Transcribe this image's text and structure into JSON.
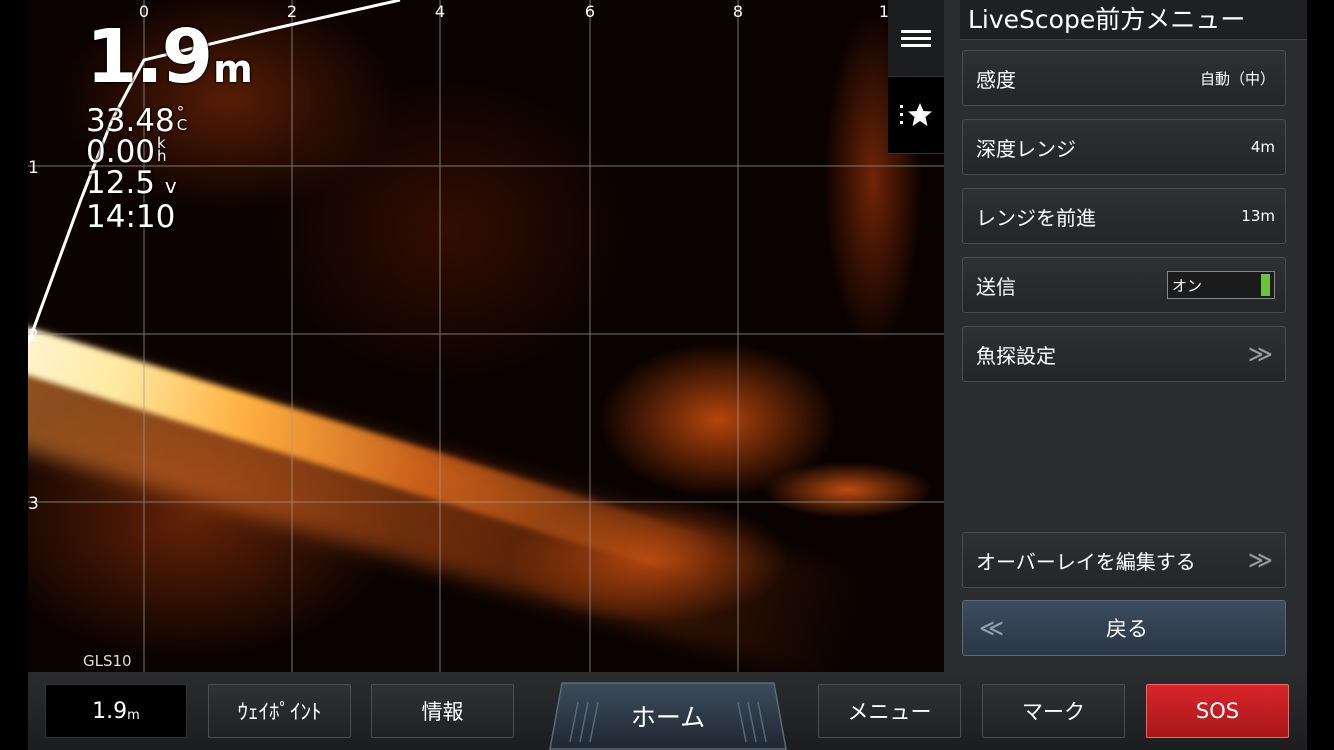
{
  "sonar": {
    "x_ticks": [
      "0",
      "2",
      "4",
      "6",
      "8",
      "1"
    ],
    "y_ticks": [
      "1",
      "2",
      "3"
    ],
    "depth": "1.9",
    "depth_unit": "m",
    "water_temp": "33.48",
    "temp_unit_top": "°",
    "temp_unit_bottom": "C",
    "speed": "0.00",
    "speed_unit_top": "k",
    "speed_unit_bottom": "h",
    "voltage": "12.5",
    "voltage_unit": "v",
    "time": "14:10",
    "transducer": "GLS10",
    "colors": {
      "echo": "#e06a1c",
      "bottom": "#ffe9a0",
      "grid": "#8a8a8a"
    }
  },
  "tool_strip": {
    "menu_icon": "hamburger-icon",
    "favorites_icon": "favorites-star-icon"
  },
  "menu": {
    "title": "LiveScope前方メニュー",
    "items": [
      {
        "label": "感度",
        "value": "自動（中）"
      },
      {
        "label": "深度レンジ",
        "value": "4m"
      },
      {
        "label": "レンジを前進",
        "value": "13m"
      },
      {
        "label": "送信",
        "value": "オン",
        "toggle_on": true
      },
      {
        "label": "魚探設定",
        "chevron": "≫"
      }
    ],
    "overlay_label": "オーバーレイを編集する",
    "overlay_chevron": "≫",
    "back_label": "戻る",
    "back_chevron": "≪"
  },
  "bottom_bar": {
    "depth": "1.9",
    "depth_unit": "m",
    "waypoint": "ｳｪｲﾎﾟｲﾝﾄ",
    "info": "情報",
    "home": "ホーム",
    "menu": "メニュー",
    "mark": "マーク",
    "sos": "SOS",
    "sos_color": "#d8262a"
  }
}
